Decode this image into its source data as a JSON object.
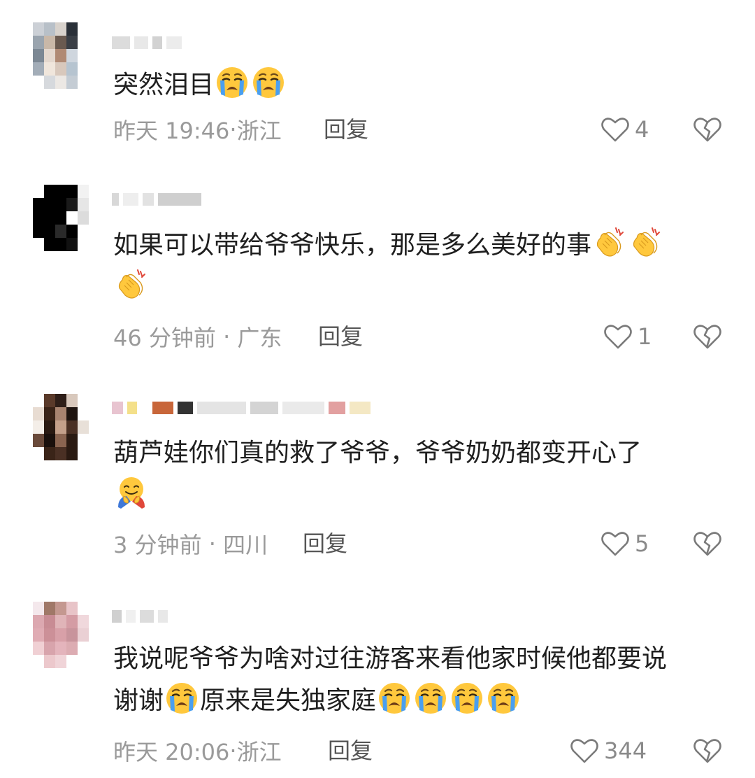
{
  "comments": [
    {
      "text_parts": [
        "突然泪目"
      ],
      "emojis_after": [
        "crying-emoji",
        "crying-emoji"
      ],
      "time": "昨天 19:46",
      "location": "浙江",
      "reply_label": "回复",
      "likes": "4"
    },
    {
      "text_parts": [
        "如果可以带给爷爷快乐，那是多么美好的事"
      ],
      "emojis_after": [
        "clapping-emoji",
        "clapping-emoji",
        "clapping-emoji"
      ],
      "time": "46 分钟前",
      "location": "广东",
      "reply_label": "回复",
      "likes": "1"
    },
    {
      "text_parts": [
        "葫芦娃你们真的救了爷爷，爷爷奶奶都变开心了"
      ],
      "emojis_after": [
        "hugging-emoji"
      ],
      "time": "3 分钟前",
      "location": "四川",
      "reply_label": "回复",
      "likes": "5"
    },
    {
      "text_line1": "我说呢爷爷为啥对过往游客来看他家时候他都要说",
      "text_line2a": "谢谢",
      "text_line2b": "原来是失独家庭",
      "emojis_after": [
        "crying-emoji",
        "crying-emoji",
        "crying-emoji",
        "crying-emoji"
      ],
      "time": "昨天 20:06",
      "location": "浙江",
      "reply_label": "回复",
      "likes": "344"
    }
  ],
  "colors": {
    "meta_text": "#9a9a9a",
    "reply_text": "#555555",
    "emoji_yellow": "#ffc83d",
    "tear_blue": "#4a9ff0"
  }
}
